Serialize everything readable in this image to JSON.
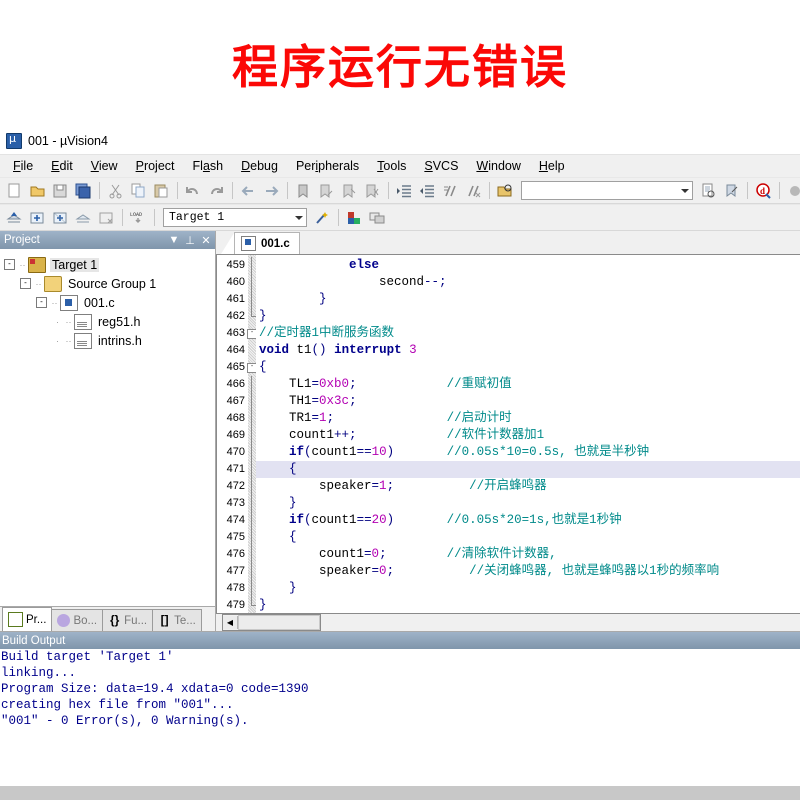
{
  "banner": {
    "text": "程序运行无错误",
    "color": "#fb0806"
  },
  "window": {
    "title": "001  - µVision4",
    "app_icon": "uvision-icon"
  },
  "menubar": {
    "items": [
      {
        "label": "File",
        "accel": "F"
      },
      {
        "label": "Edit",
        "accel": "E"
      },
      {
        "label": "View",
        "accel": "V"
      },
      {
        "label": "Project",
        "accel": "P"
      },
      {
        "label": "Flash",
        "accel": "a"
      },
      {
        "label": "Debug",
        "accel": "D"
      },
      {
        "label": "Peripherals",
        "accel": "i"
      },
      {
        "label": "Tools",
        "accel": "T"
      },
      {
        "label": "SVCS",
        "accel": "S"
      },
      {
        "label": "Window",
        "accel": "W"
      },
      {
        "label": "Help",
        "accel": "H"
      }
    ]
  },
  "toolbar_main": {
    "icons": [
      "new-file-icon",
      "open-file-icon",
      "save-icon",
      "save-all-icon",
      "sep",
      "cut-icon",
      "copy-icon",
      "paste-icon",
      "sep",
      "undo-icon",
      "redo-icon",
      "sep",
      "navigate-back-icon",
      "navigate-forward-icon",
      "sep",
      "bookmark-toggle-icon",
      "bookmark-prev-icon",
      "bookmark-next-icon",
      "bookmark-clear-icon",
      "sep",
      "indent-icon",
      "outdent-icon",
      "comment-icon",
      "uncomment-icon",
      "sep",
      "open-folder-doc-icon"
    ],
    "search_box_value": "",
    "search_box_placeholder": "",
    "icons_right": [
      "find-in-files-icon",
      "bookmark-find-icon",
      "sep",
      "debug-search-icon",
      "sep",
      "breakpoint-disabled-icon",
      "breakpoint-hollow-icon",
      "breakpoint-kill-all-icon",
      "breakpoint-red-icon"
    ]
  },
  "toolbar_build": {
    "icons": [
      "translate-icon",
      "build-target-icon",
      "rebuild-all-icon",
      "batch-build-icon",
      "stop-build-icon",
      "sep",
      "download-load-icon",
      "sep"
    ],
    "target_value": "Target 1",
    "icons_right": [
      "target-options-wizard-icon",
      "sep",
      "manage-components-icon",
      "manage-multi-project-icon"
    ]
  },
  "project_panel": {
    "title": "Project",
    "buttons": [
      "chevron-down-icon",
      "pin-icon",
      "close-icon"
    ],
    "tree": [
      {
        "depth": 0,
        "label": "Target 1",
        "icon": "target-icon",
        "toggle": "-",
        "selected": true
      },
      {
        "depth": 1,
        "label": "Source Group 1",
        "icon": "folder-icon",
        "toggle": "-",
        "selected": false
      },
      {
        "depth": 2,
        "label": "001.c",
        "icon": "c-file-icon",
        "toggle": "-",
        "selected": false
      },
      {
        "depth": 3,
        "label": "reg51.h",
        "icon": "h-file-icon",
        "toggle": "",
        "selected": false
      },
      {
        "depth": 3,
        "label": "intrins.h",
        "icon": "h-file-icon",
        "toggle": "",
        "selected": false
      }
    ],
    "tabs": [
      {
        "label": "Pr...",
        "icon": "project-icon",
        "active": true
      },
      {
        "label": "Bo...",
        "icon": "books-icon",
        "active": false
      },
      {
        "label": "Fu...",
        "icon": "functions-icon",
        "active": false
      },
      {
        "label": "Te...",
        "icon": "templates-icon",
        "active": false
      }
    ]
  },
  "editor": {
    "tabs": [
      {
        "label": "001.c",
        "icon": "c-file-icon",
        "active": true
      }
    ],
    "first_line_number": 459,
    "highlight_line": 471,
    "lines": [
      {
        "n": 459,
        "fold": "v",
        "code": "            else"
      },
      {
        "n": 460,
        "fold": "v",
        "code": "                second--;"
      },
      {
        "n": 461,
        "fold": "v",
        "code": "        }"
      },
      {
        "n": 462,
        "fold": "e",
        "code": "}"
      },
      {
        "n": 463,
        "fold": "b",
        "code": "//定时器1中断服务函数"
      },
      {
        "n": 464,
        "fold": "",
        "code": "void t1() interrupt 3"
      },
      {
        "n": 465,
        "fold": "b",
        "code": "{"
      },
      {
        "n": 466,
        "fold": "v",
        "code": "    TL1=0xb0;            //重赋初值"
      },
      {
        "n": 467,
        "fold": "v",
        "code": "    TH1=0x3c;"
      },
      {
        "n": 468,
        "fold": "v",
        "code": "    TR1=1;               //启动计时"
      },
      {
        "n": 469,
        "fold": "v",
        "code": "    count1++;            //软件计数器加1"
      },
      {
        "n": 470,
        "fold": "v",
        "code": "    if(count1==10)       //0.05s*10=0.5s, 也就是半秒钟"
      },
      {
        "n": 471,
        "fold": "v",
        "code": "    {"
      },
      {
        "n": 472,
        "fold": "v",
        "code": "        speaker=1;          //开启蜂鸣器"
      },
      {
        "n": 473,
        "fold": "v",
        "code": "    }"
      },
      {
        "n": 474,
        "fold": "v",
        "code": "    if(count1==20)       //0.05s*20=1s,也就是1秒钟"
      },
      {
        "n": 475,
        "fold": "v",
        "code": "    {"
      },
      {
        "n": 476,
        "fold": "v",
        "code": "        count1=0;        //清除软件计数器,"
      },
      {
        "n": 477,
        "fold": "v",
        "code": "        speaker=0;          //关闭蜂鸣器, 也就是蜂鸣器以1秒的频率响"
      },
      {
        "n": 478,
        "fold": "v",
        "code": "    }"
      },
      {
        "n": 479,
        "fold": "e",
        "code": "}"
      }
    ],
    "hscroll": {
      "left_arrow": "triangle-left-icon"
    }
  },
  "build_output": {
    "title": "Build Output",
    "lines": [
      "Build target 'Target 1'",
      "linking...",
      "Program Size: data=19.4 xdata=0 code=1390",
      "creating hex file from \"001\"...",
      "\"001\" - 0 Error(s), 0 Warning(s)."
    ]
  },
  "colors": {
    "keyword": "#00008b",
    "number": "#b300b3",
    "comment": "#008a8a",
    "highlight_line": "#e2e2f2",
    "panel_header": "#7f95ab"
  }
}
